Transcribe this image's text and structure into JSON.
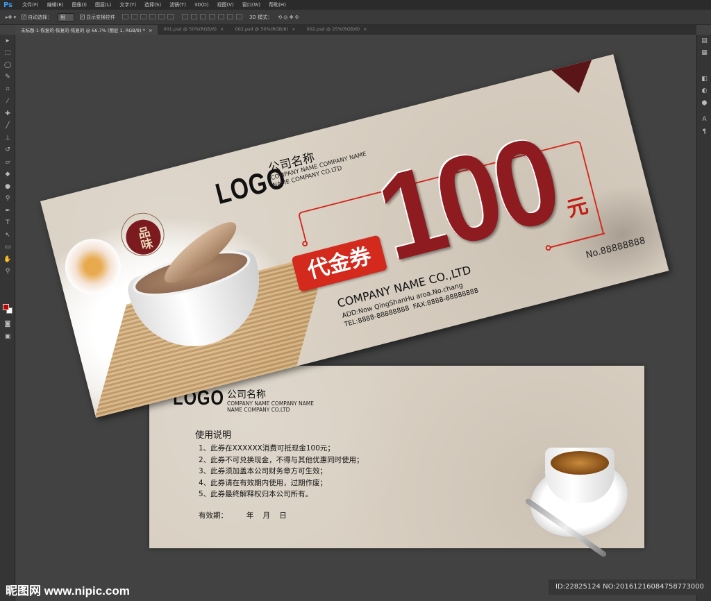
{
  "app": {
    "logo": "Ps"
  },
  "menu": [
    "文件(F)",
    "编辑(E)",
    "图像(I)",
    "图层(L)",
    "文字(Y)",
    "选择(S)",
    "滤镜(T)",
    "3D(D)",
    "视图(V)",
    "窗口(W)",
    "帮助(H)"
  ],
  "options": {
    "auto_select_label": "自动选择：",
    "auto_select_value": "组",
    "show_transform_label": "显示变换控件",
    "mode_3d_label": "3D 模式："
  },
  "tabs": [
    {
      "label": "未标题-1-恢复的-恢复的-恢复的 @ 66.7% (图层 1, RGB/8) *",
      "active": true
    },
    {
      "label": "001.psd @ 50%(RGB/8)",
      "active": false
    },
    {
      "label": "002.psd @ 50%(RGB/8)",
      "active": false
    },
    {
      "label": "002.psd @ 25%(RGB/8)",
      "active": false
    }
  ],
  "tools": [
    "move-icon",
    "marquee-icon",
    "lasso-icon",
    "quick-select-icon",
    "crop-icon",
    "eyedropper-icon",
    "healing-icon",
    "brush-icon",
    "stamp-icon",
    "history-brush-icon",
    "eraser-icon",
    "bucket-icon",
    "blur-icon",
    "dodge-icon",
    "pen-icon",
    "type-icon",
    "path-select-icon",
    "shape-icon",
    "hand-icon",
    "zoom-icon"
  ],
  "colors": {
    "foreground": "#c40000",
    "background": "#ffffff",
    "accent_red": "#8e1b20",
    "label_red": "#d42a1e"
  },
  "front": {
    "logo": "LOGO",
    "company_cn": "公司名称",
    "company_en_1": "COMPANY NAME COMPANY NAME",
    "company_en_2": "NAME COMPANY CO.LTD",
    "badge": "品味",
    "voucher_label": "代金券",
    "amount": "100",
    "unit": "元",
    "serial": "No.88888888",
    "company": "COMPANY NAME CO.,LTD",
    "address": "ADD:Now QingShanHu aroa.No.chang",
    "contact": "TEL:8888-88888888  FAX:8888-88888888"
  },
  "back": {
    "logo": "LOGO",
    "company_cn": "公司名称",
    "company_en_1": "COMPANY NAME COMPANY NAME",
    "company_en_2": "NAME COMPANY CO.LTD",
    "title": "使用说明",
    "rules": [
      "1、此券在XXXXXX消费可抵现金100元；",
      "2、此券不可兑换现金，不得与其他优惠同时使用；",
      "3、此券须加盖本公司财务章方可生效；",
      "4、此券请在有效期内使用，过期作废；",
      "5、此券最终解释权归本公司所有。"
    ],
    "validity": "有效期：        年    月    日"
  },
  "watermark": {
    "site": "昵图网 www.nipic.com",
    "id": "ID:22825124 NO:20161216084758773000"
  }
}
